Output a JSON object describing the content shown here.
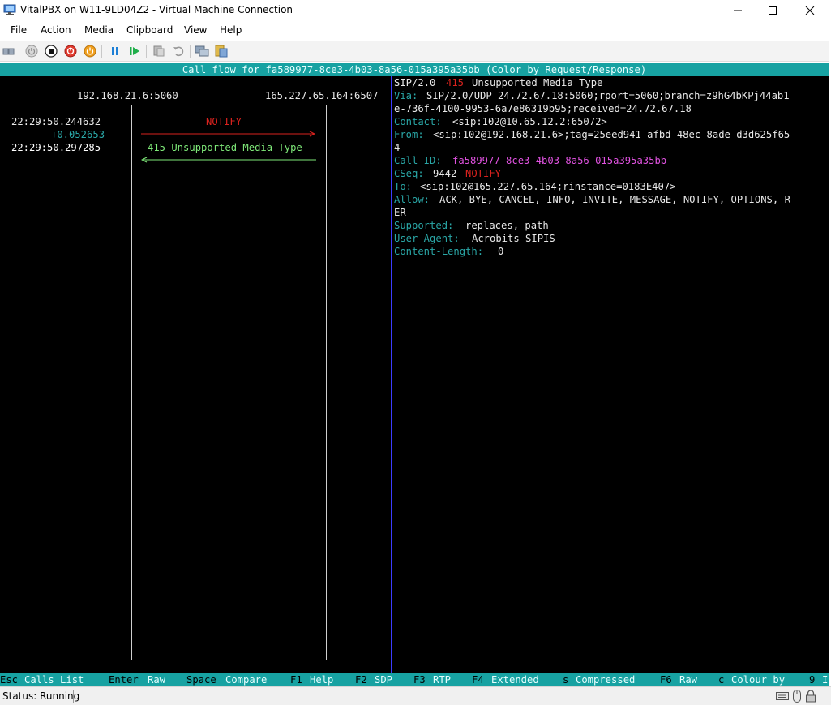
{
  "window": {
    "title": "VitalPBX on W11-9LD04Z2 - Virtual Machine Connection",
    "app_icon": "vm-connection-icon"
  },
  "menu": [
    "File",
    "Action",
    "Media",
    "Clipboard",
    "View",
    "Help"
  ],
  "toolbar": {
    "icons": [
      "ctrl-alt-del-icon",
      "start-icon",
      "turn-off-icon",
      "shut-down-icon",
      "power-icon",
      "pause-icon",
      "resume-icon",
      "checkpoint-icon",
      "revert-icon",
      "enhanced-session-icon",
      "share-icon"
    ]
  },
  "terminal": {
    "header": "Call flow for fa589977-8ce3-4b03-8a56-015a395a35bb (Color by Request/Response)",
    "endpoint_a": "192.168.21.6:5060",
    "endpoint_b": "165.227.65.164:6507",
    "rows": [
      {
        "time": "22:29:50.244632",
        "delta": "",
        "label": "NOTIFY",
        "direction": "right"
      },
      {
        "time": "",
        "delta": "+0.052653",
        "label": "",
        "direction": ""
      },
      {
        "time": "22:29:50.297285",
        "delta": "",
        "label": "415 Unsupported Media Type",
        "direction": "left"
      }
    ],
    "sip": {
      "status_prefix": "SIP/2.0",
      "status_code": "415",
      "status_text": "Unsupported Media Type",
      "via_label": "Via:",
      "via_value_1": "SIP/2.0/UDP 24.72.67.18:5060;rport=5060;branch=z9hG4bKPj44ab1",
      "via_value_2": "e-736f-4100-9953-6a7e86319b95;received=24.72.67.18",
      "contact_label": "Contact:",
      "contact_value": "<sip:102@10.65.12.2:65072>",
      "from_label": "From:",
      "from_value_1": "<sip:102@192.168.21.6>;tag=25eed941-afbd-48ec-8ade-d3d625f65",
      "from_value_2": "4",
      "callid_label": "Call-ID:",
      "callid_value": "fa589977-8ce3-4b03-8a56-015a395a35bb",
      "cseq_label": "CSeq:",
      "cseq_number": "9442",
      "cseq_method": "NOTIFY",
      "to_label": "To:",
      "to_value": "<sip:102@165.227.65.164;rinstance=0183E407>",
      "allow_label": "Allow:",
      "allow_value_1": "ACK, BYE, CANCEL, INFO, INVITE, MESSAGE, NOTIFY, OPTIONS, R",
      "allow_value_2": "ER",
      "supported_label": "Supported:",
      "supported_value": "replaces, path",
      "ua_label": "User-Agent:",
      "ua_value": "Acrobits SIPIS",
      "cl_label": "Content-Length:",
      "cl_value": "0"
    },
    "keys": [
      {
        "key": "Esc",
        "label": "Calls List"
      },
      {
        "key": "Enter",
        "label": "Raw"
      },
      {
        "key": "Space",
        "label": "Compare"
      },
      {
        "key": "F1",
        "label": "Help"
      },
      {
        "key": "F2",
        "label": "SDP"
      },
      {
        "key": "F3",
        "label": "RTP"
      },
      {
        "key": "F4",
        "label": "Extended"
      },
      {
        "key": "s",
        "label": "Compressed"
      },
      {
        "key": "F6",
        "label": "Raw"
      },
      {
        "key": "c",
        "label": "Colour by"
      },
      {
        "key": "9",
        "label": "I"
      }
    ]
  },
  "status": {
    "text": "Status: Running",
    "icons": [
      "keyboard-icon",
      "mouse-icon",
      "lock-icon"
    ]
  },
  "colors": {
    "terminal_bg": "#000000",
    "header_bg": "#17a2a2",
    "request": "#d9221e",
    "response": "#7ee878",
    "callid": "#e052e0"
  }
}
